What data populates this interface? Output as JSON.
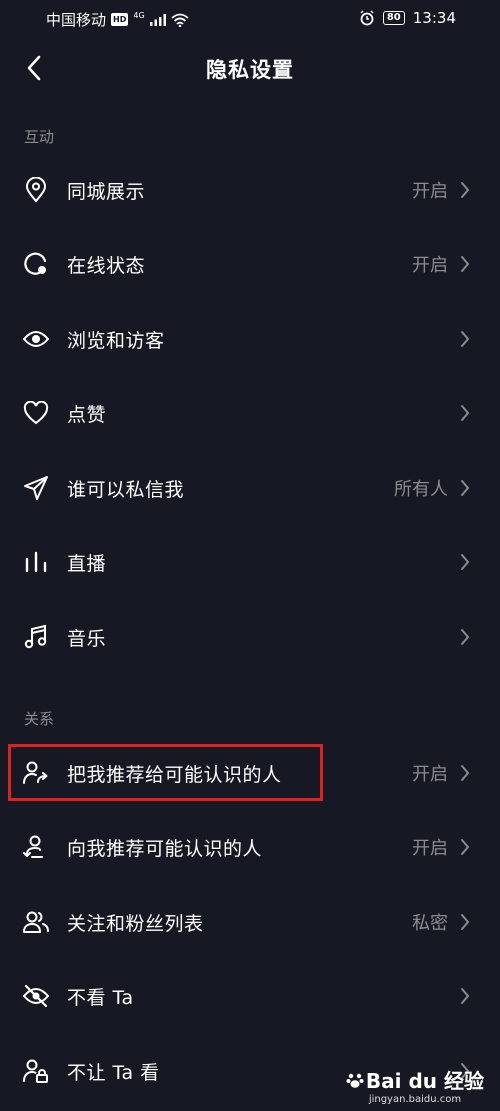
{
  "status_bar": {
    "carrier": "中国移动",
    "hd": "HD",
    "network": "4G",
    "battery": "80",
    "time": "13:34"
  },
  "header": {
    "title": "隐私设置"
  },
  "sections": [
    {
      "label": "互动",
      "items": [
        {
          "label": "同城展示",
          "value": "开启",
          "icon": "location-pin-icon"
        },
        {
          "label": "在线状态",
          "value": "开启",
          "icon": "online-status-icon"
        },
        {
          "label": "浏览和访客",
          "value": "",
          "icon": "eye-icon"
        },
        {
          "label": "点赞",
          "value": "",
          "icon": "heart-icon"
        },
        {
          "label": "谁可以私信我",
          "value": "所有人",
          "icon": "send-icon"
        },
        {
          "label": "直播",
          "value": "",
          "icon": "live-bars-icon"
        },
        {
          "label": "音乐",
          "value": "",
          "icon": "music-note-icon"
        }
      ]
    },
    {
      "label": "关系",
      "items": [
        {
          "label": "把我推荐给可能认识的人",
          "value": "开启",
          "icon": "user-share-icon"
        },
        {
          "label": "向我推荐可能认识的人",
          "value": "开启",
          "icon": "user-recommend-icon"
        },
        {
          "label": "关注和粉丝列表",
          "value": "私密",
          "icon": "users-icon"
        },
        {
          "label": "不看 Ta",
          "value": "",
          "icon": "eye-off-icon"
        },
        {
          "label": "不让 Ta 看",
          "value": "",
          "icon": "user-lock-icon"
        }
      ]
    }
  ],
  "watermark": {
    "brand": "Bai du 经验",
    "url": "jingyan.baidu.com"
  },
  "colors": {
    "background": "#161823",
    "secondary_text": "#8a8b91",
    "highlight": "#e02020"
  }
}
